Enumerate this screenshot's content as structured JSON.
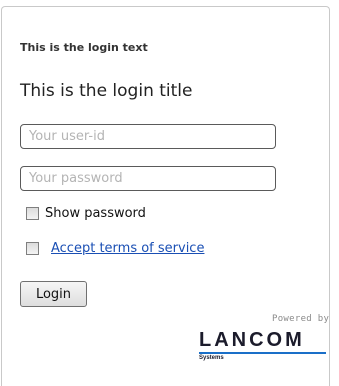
{
  "login": {
    "text": "This is the login text",
    "title": "This is the login title",
    "userid_placeholder": "Your user-id",
    "password_placeholder": "Your password",
    "show_password_label": "Show password",
    "accept_terms_label": "Accept terms of service",
    "login_button_label": "Login"
  },
  "footer": {
    "powered_by": "Powered by",
    "brand": "LANCOM",
    "brand_sub": "Systems",
    "brand_accent_color": "#1a6fc8"
  }
}
